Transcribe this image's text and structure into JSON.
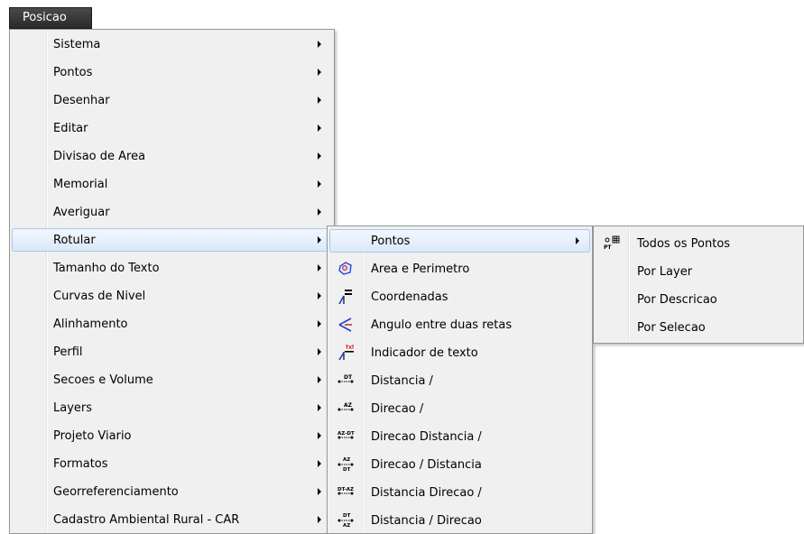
{
  "menubar": {
    "title": "Posicao"
  },
  "main_menu": {
    "items": [
      {
        "label": "Sistema"
      },
      {
        "label": "Pontos"
      },
      {
        "label": "Desenhar"
      },
      {
        "label": "Editar"
      },
      {
        "label": "Divisao de Area"
      },
      {
        "label": "Memorial"
      },
      {
        "label": "Averiguar"
      },
      {
        "label": "Rotular"
      },
      {
        "label": "Tamanho do Texto"
      },
      {
        "label": "Curvas de Nivel"
      },
      {
        "label": "Alinhamento"
      },
      {
        "label": "Perfil"
      },
      {
        "label": "Secoes e Volume"
      },
      {
        "label": "Layers"
      },
      {
        "label": "Projeto Viario"
      },
      {
        "label": "Formatos"
      },
      {
        "label": "Georreferenciamento"
      },
      {
        "label": "Cadastro Ambiental Rural - CAR"
      }
    ]
  },
  "rotular_menu": {
    "items": [
      {
        "label": "Pontos"
      },
      {
        "label": "Area e Perimetro",
        "icon": "area-perimeter-icon"
      },
      {
        "label": "Coordenadas",
        "icon": "coordinates-icon"
      },
      {
        "label": "Angulo entre duas retas",
        "icon": "angle-icon"
      },
      {
        "label": "Indicador de texto",
        "icon": "text-indicator-icon"
      },
      {
        "label": "Distancia /",
        "icon": "distance-icon",
        "icon_text": "DT"
      },
      {
        "label": "Direcao /",
        "icon": "direction-icon",
        "icon_text": "AZ"
      },
      {
        "label": "Direcao Distancia /",
        "icon": "direction-distance-icon",
        "icon_text": "AZ-DT"
      },
      {
        "label": "Direcao / Distancia",
        "icon": "direction-over-distance-icon",
        "icon_text": "AZ DT"
      },
      {
        "label": "Distancia Direcao /",
        "icon": "distance-direction-icon",
        "icon_text": "DT-AZ"
      },
      {
        "label": "Distancia / Direcao",
        "icon": "distance-over-direction-icon",
        "icon_text": "DT AZ"
      }
    ]
  },
  "pontos_menu": {
    "items": [
      {
        "label": "Todos os Pontos",
        "icon": "all-points-icon"
      },
      {
        "label": "Por Layer"
      },
      {
        "label": "Por Descricao"
      },
      {
        "label": "Por Selecao"
      }
    ]
  },
  "colors": {
    "highlight_border": "#a8c8ef",
    "menu_bg": "#f0f0f0",
    "menubar_bg": "#333333",
    "icon_blue": "#1a3fd0",
    "icon_red": "#cc1111"
  }
}
